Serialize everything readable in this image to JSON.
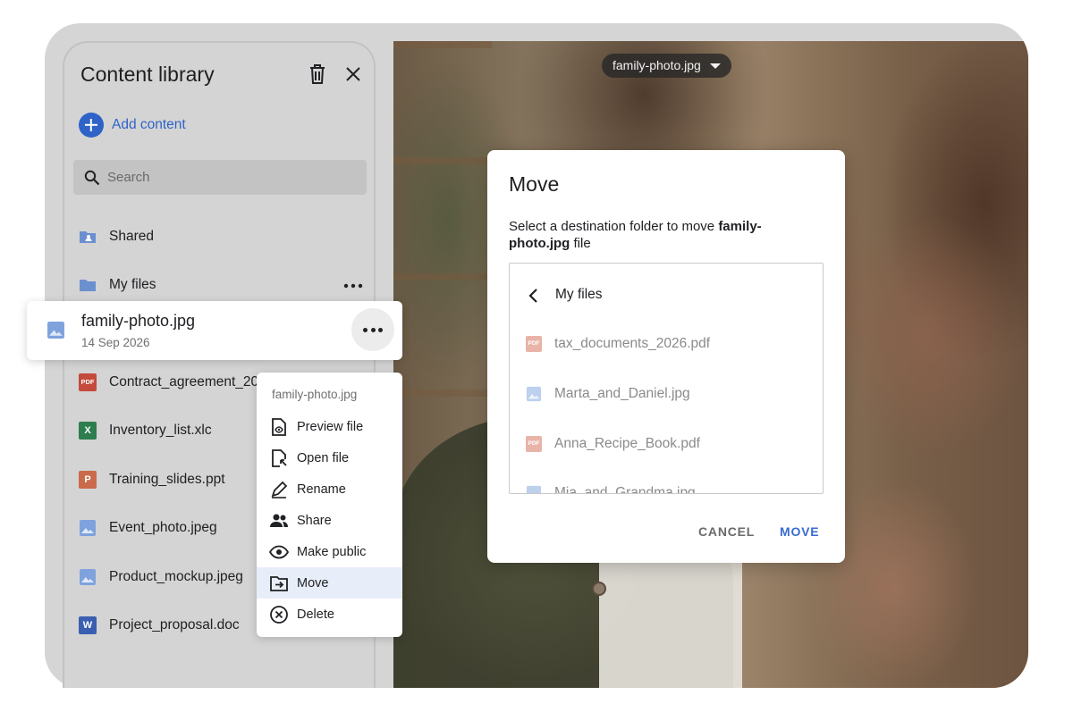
{
  "photo": {
    "file_name": "family-photo.jpg"
  },
  "sidebar": {
    "title": "Content library",
    "add_content": "Add content",
    "search_placeholder": "Search",
    "items": [
      {
        "label": "Shared",
        "icon": "shared-folder-icon"
      },
      {
        "label": "My files",
        "icon": "folder-icon"
      },
      {
        "label": "family-photo.jpg",
        "date": "14 Sep 2026",
        "icon": "image-icon"
      },
      {
        "label": "Contract_agreement_20",
        "icon": "pdf-icon",
        "icon_text": "PDF"
      },
      {
        "label": "Inventory_list.xlc",
        "icon": "excel-icon",
        "icon_text": "X"
      },
      {
        "label": "Training_slides.ppt",
        "icon": "powerpoint-icon",
        "icon_text": "P"
      },
      {
        "label": "Event_photo.jpeg",
        "icon": "image-icon"
      },
      {
        "label": "Product_mockup.jpeg",
        "icon": "image-icon"
      },
      {
        "label": "Project_proposal.doc",
        "icon": "word-icon",
        "icon_text": "W"
      }
    ]
  },
  "context_menu": {
    "title": "family-photo.jpg",
    "items": [
      {
        "label": "Preview file",
        "icon": "preview-icon"
      },
      {
        "label": "Open file",
        "icon": "open-file-icon"
      },
      {
        "label": "Rename",
        "icon": "rename-icon"
      },
      {
        "label": "Share",
        "icon": "share-icon"
      },
      {
        "label": "Make public",
        "icon": "eye-icon"
      },
      {
        "label": "Move",
        "icon": "move-icon",
        "active": true
      },
      {
        "label": "Delete",
        "icon": "delete-icon"
      }
    ]
  },
  "dialog": {
    "title": "Move",
    "desc_prefix": "Select a destination folder to move ",
    "desc_file": "family-photo.jpg",
    "desc_suffix": " file",
    "current_folder": "My files",
    "files": [
      {
        "name": "tax_documents_2026.pdf",
        "icon": "pdf-icon"
      },
      {
        "name": "Marta_and_Daniel.jpg",
        "icon": "image-icon"
      },
      {
        "name": "Anna_Recipe_Book.pdf",
        "icon": "pdf-icon"
      },
      {
        "name": "Mia_and_Grandma.jpg",
        "icon": "image-icon"
      }
    ],
    "cancel": "CANCEL",
    "move": "MOVE"
  },
  "colors": {
    "accent": "#2f63c8",
    "move_button": "#3a6bd0",
    "pdf": "#c44a3c",
    "excel": "#2e7d4f",
    "powerpoint": "#c96a4a",
    "word": "#3a5fb0",
    "folder": "#6b8fcf",
    "menu_active": "#e8eef9"
  }
}
